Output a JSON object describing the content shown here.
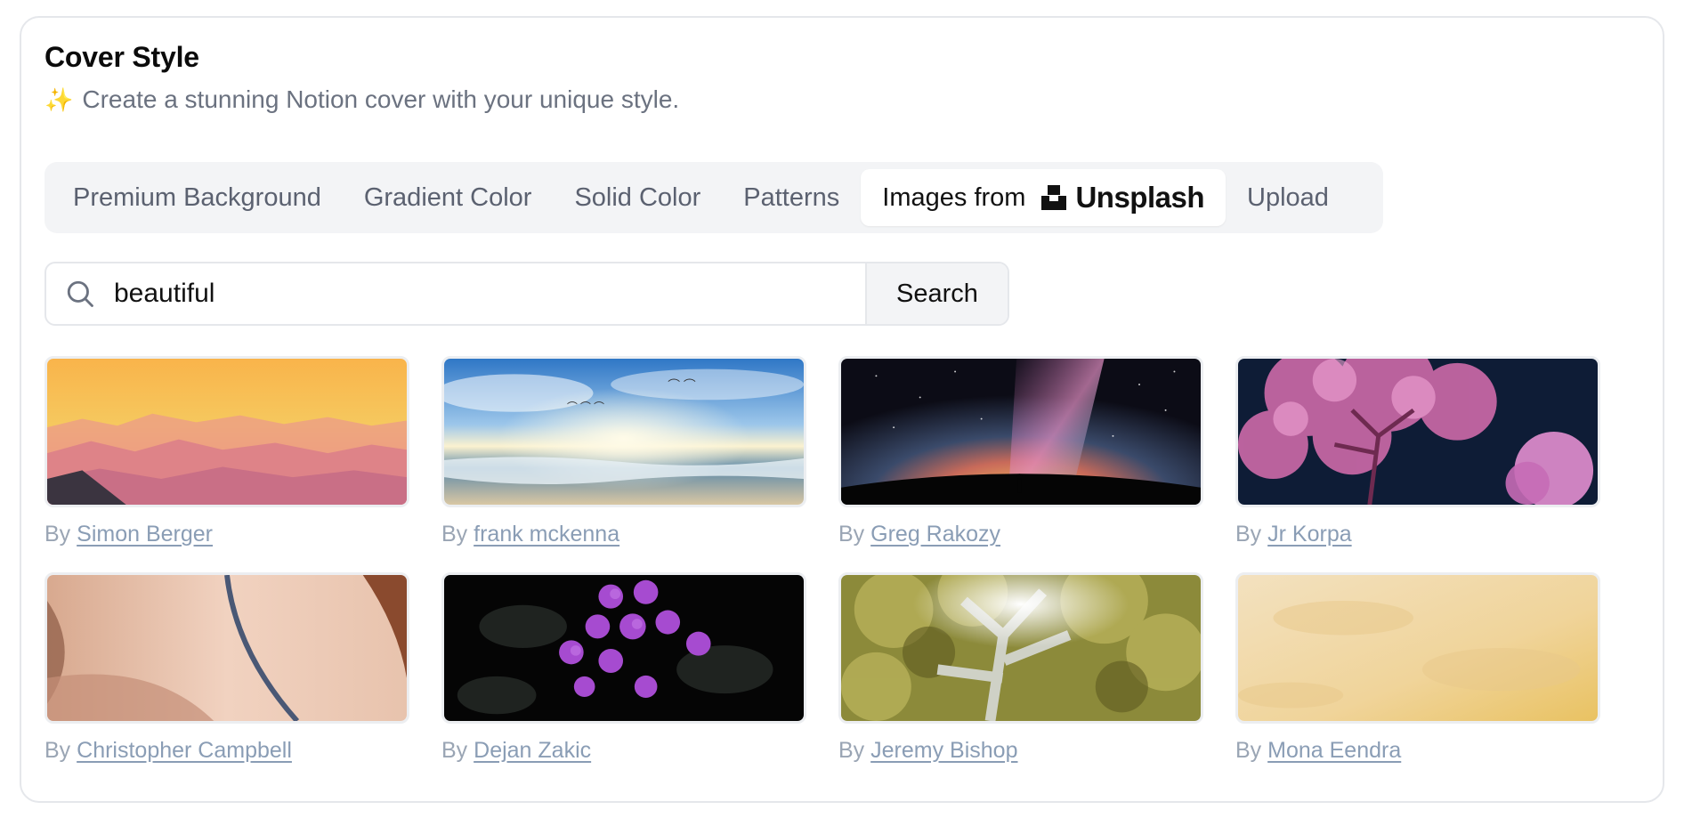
{
  "header": {
    "title": "Cover Style",
    "subtitle": "Create a stunning Notion cover with your unique style.",
    "subtitle_icon": "sparkles-icon"
  },
  "tabs": [
    {
      "label": "Premium Background",
      "active": false
    },
    {
      "label": "Gradient Color",
      "active": false
    },
    {
      "label": "Solid Color",
      "active": false
    },
    {
      "label": "Patterns",
      "active": false
    },
    {
      "label": "Images from",
      "active": true,
      "brand": "Unsplash"
    },
    {
      "label": "Upload",
      "active": false
    }
  ],
  "search": {
    "value": "beautiful",
    "button_label": "Search",
    "icon": "search-icon"
  },
  "images": [
    {
      "by": "By",
      "author": "Simon Berger",
      "subject": "sunset-mountains"
    },
    {
      "by": "By",
      "author": "frank mckenna",
      "subject": "beach-birds"
    },
    {
      "by": "By",
      "author": "Greg Rakozy",
      "subject": "milky-way"
    },
    {
      "by": "By",
      "author": "Jr Korpa",
      "subject": "pink-tree"
    },
    {
      "by": "By",
      "author": "Christopher Campbell",
      "subject": "back-portrait"
    },
    {
      "by": "By",
      "author": "Dejan Zakic",
      "subject": "purple-flowers"
    },
    {
      "by": "By",
      "author": "Jeremy Bishop",
      "subject": "sunlit-tree"
    },
    {
      "by": "By",
      "author": "Mona Eendra",
      "subject": "yellow-texture"
    }
  ]
}
